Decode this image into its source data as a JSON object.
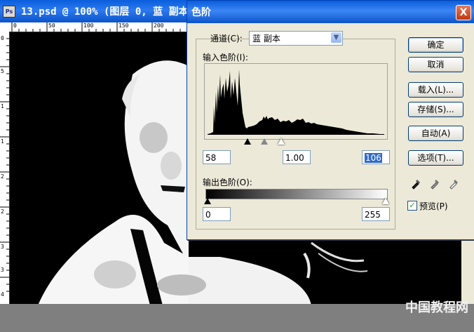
{
  "document": {
    "title": "13.psd @ 100% (图层 0, 蓝 副本/8",
    "ruler_h_labels": [
      "0",
      "50",
      "100",
      "150",
      "200"
    ],
    "ruler_v_labels": [
      "0",
      "5",
      "1",
      "1",
      "2",
      "2",
      "3",
      "3",
      "4"
    ],
    "watermark": "中国教程网"
  },
  "dialog": {
    "title": "色阶",
    "close_label": "X",
    "channel_label": "通道(C):",
    "channel_value": "蓝 副本",
    "input_levels_label": "输入色阶(I):",
    "input_black": "58",
    "input_gamma": "1.00",
    "input_white": "106",
    "output_levels_label": "输出色阶(O):",
    "output_black": "0",
    "output_white": "255",
    "buttons": {
      "ok": "确定",
      "cancel": "取消",
      "load": "载入(L)...",
      "save": "存储(S)...",
      "auto": "自动(A)",
      "options": "选项(T)..."
    },
    "preview_label": "预览(P)",
    "preview_checked": true
  }
}
